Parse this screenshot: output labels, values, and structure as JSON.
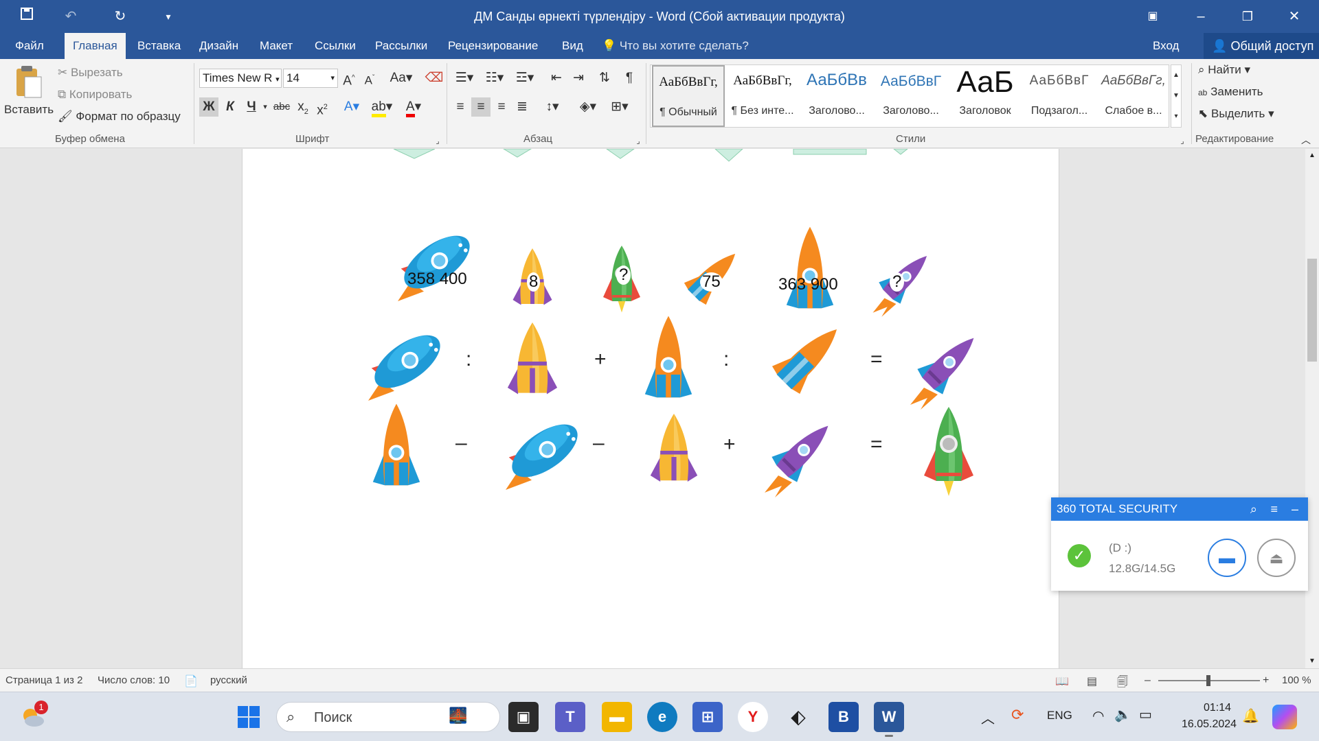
{
  "window": {
    "title": "ДМ Санды өрнекті түрлендіру - Word (Сбой активации продукта)"
  },
  "tabs": [
    "Файл",
    "Главная",
    "Вставка",
    "Дизайн",
    "Макет",
    "Ссылки",
    "Рассылки",
    "Рецензирование",
    "Вид"
  ],
  "tell_me": "Что вы хотите сделать?",
  "signin": "Вход",
  "share": "Общий доступ",
  "clipboard": {
    "paste": "Вставить",
    "cut": "Вырезать",
    "copy": "Копировать",
    "format_painter": "Формат по образцу",
    "label": "Буфер обмена"
  },
  "font": {
    "name": "Times New R",
    "size": "14",
    "bold": "Ж",
    "italic": "К",
    "underline": "Ч",
    "strike": "abc",
    "change_case": "Aa",
    "label": "Шрифт"
  },
  "paragraph": {
    "label": "Абзац"
  },
  "styles": {
    "label": "Стили",
    "items": [
      {
        "sample": "АаБбВвГг,",
        "name": "¶ Обычный"
      },
      {
        "sample": "АаБбВвГг,",
        "name": "¶ Без инте..."
      },
      {
        "sample": "АаБбВв",
        "name": "Заголово..."
      },
      {
        "sample": "АаБбВвГ",
        "name": "Заголово..."
      },
      {
        "sample": "АаБ",
        "name": "Заголовок"
      },
      {
        "sample": "АаБбВвГ",
        "name": "Подзагол..."
      },
      {
        "sample": "АаБбВвГг,",
        "name": "Слабое в..."
      }
    ]
  },
  "editing": {
    "find": "Найти",
    "replace": "Заменить",
    "select": "Выделить",
    "label": "Редактирование"
  },
  "puzzle": {
    "row1_labels": [
      "358 400",
      "8",
      "?",
      "75",
      "363 900",
      "?"
    ],
    "ops_row2": [
      ":",
      "+",
      ":",
      "="
    ],
    "ops_row3": [
      "–",
      "–",
      "+",
      "="
    ]
  },
  "security_popup": {
    "title": "360 TOTAL SECURITY",
    "drive": "(D :)",
    "usage": "12.8G/14.5G"
  },
  "statusbar": {
    "page": "Страница 1 из 2",
    "words": "Число слов: 10",
    "language": "русский",
    "zoom": "100 %"
  },
  "taskbar": {
    "search_placeholder": "Поиск",
    "notification_count": "1",
    "lang": "ENG",
    "time": "01:14",
    "date": "16.05.2024"
  },
  "colors": {
    "word_blue": "#2b579a",
    "rocket_blue": "#1f9ad6",
    "rocket_orange": "#f58a1f",
    "rocket_yellow": "#f7b733",
    "rocket_purple": "#8a4fb7",
    "rocket_green": "#4caf50",
    "security_blue": "#2a7de1"
  }
}
